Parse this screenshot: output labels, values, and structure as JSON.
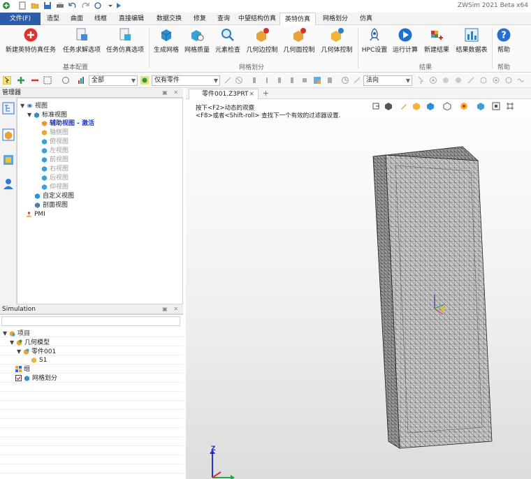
{
  "app": {
    "title": "ZWSim 2021 Beta x64"
  },
  "ribbon_tabs": [
    {
      "label": "文件(F)",
      "state": "file"
    },
    {
      "label": "造型"
    },
    {
      "label": "曲面"
    },
    {
      "label": "线框"
    },
    {
      "label": "直接编辑"
    },
    {
      "label": "数据交换"
    },
    {
      "label": "修复"
    },
    {
      "label": "查询"
    },
    {
      "label": "中望结构仿真"
    },
    {
      "label": "英特仿真",
      "state": "active"
    },
    {
      "label": "网格划分"
    },
    {
      "label": "仿真"
    }
  ],
  "ribbon": {
    "buttons": [
      {
        "label": "新建英特仿真任务",
        "icon": "add-icon"
      },
      {
        "label": "任务求解选项",
        "icon": "solver-options-icon"
      },
      {
        "label": "任务仿真选项",
        "icon": "simulation-options-icon"
      },
      {
        "label": "生成网格",
        "icon": "generate-mesh-icon"
      },
      {
        "label": "网格质量",
        "icon": "mesh-quality-icon"
      },
      {
        "label": "元素检查",
        "icon": "element-check-icon"
      },
      {
        "label": "几何边控制",
        "icon": "edge-control-icon"
      },
      {
        "label": "几何面控制",
        "icon": "face-control-icon"
      },
      {
        "label": "几何体控制",
        "icon": "body-control-icon"
      },
      {
        "label": "HPC设置",
        "icon": "hpc-rocket-icon"
      },
      {
        "label": "运行计算",
        "icon": "run-play-icon"
      },
      {
        "label": "新建结果",
        "icon": "new-result-icon"
      },
      {
        "label": "结果数据表",
        "icon": "result-table-icon"
      },
      {
        "label": "帮助",
        "icon": "help-icon"
      }
    ],
    "groups": {
      "basic": "基本配置",
      "mesh": "网格划分",
      "result": "结果",
      "help": "帮助"
    }
  },
  "toolbar2": {
    "filter_value": "全部",
    "part_filter_value": "仅有零件",
    "view_mode_value": "法向"
  },
  "manager": {
    "title": "管理器",
    "tree": [
      {
        "label": "视图",
        "level": 0,
        "expand": "▼",
        "icon": "view-folder-icon"
      },
      {
        "label": "标准视图",
        "level": 1,
        "expand": "▼",
        "icon": "standard-view-icon"
      },
      {
        "label": "辅助视图 - 激活",
        "level": 2,
        "icon": "aux-view-icon",
        "style": "active"
      },
      {
        "label": "轴侧图",
        "level": 2,
        "icon": "iso-view-icon",
        "style": "grey"
      },
      {
        "label": "俯视图",
        "level": 2,
        "icon": "top-view-icon",
        "style": "grey"
      },
      {
        "label": "左视图",
        "level": 2,
        "icon": "left-view-icon",
        "style": "grey"
      },
      {
        "label": "前视图",
        "level": 2,
        "icon": "front-view-icon",
        "style": "grey"
      },
      {
        "label": "右视图",
        "level": 2,
        "icon": "right-view-icon",
        "style": "grey"
      },
      {
        "label": "后视图",
        "level": 2,
        "icon": "back-view-icon",
        "style": "grey"
      },
      {
        "label": "仰视图",
        "level": 2,
        "icon": "bottom-view-icon",
        "style": "grey"
      },
      {
        "label": "自定义视图",
        "level": 1,
        "icon": "custom-view-icon"
      },
      {
        "label": "剖面视图",
        "level": 1,
        "icon": "section-view-icon"
      },
      {
        "label": "PMI",
        "level": 0,
        "icon": "pmi-icon"
      }
    ]
  },
  "simulation": {
    "title": "Simulation",
    "tree": [
      {
        "label": "项目",
        "level": 0,
        "expand": "▼",
        "icon": "project-icon"
      },
      {
        "label": "几何模型",
        "level": 1,
        "expand": "▼",
        "icon": "geometry-model-icon"
      },
      {
        "label": "零件001",
        "level": 2,
        "expand": "▼",
        "icon": "part-icon"
      },
      {
        "label": "S1",
        "level": 3,
        "icon": "solid-icon"
      },
      {
        "label": "组",
        "level": 0,
        "icon": "group-icon"
      },
      {
        "label": "网格划分",
        "level": 0,
        "icon": "mesh-icon",
        "checked": true
      }
    ]
  },
  "viewport": {
    "tab_label": "零件001.Z3PRT",
    "hint_line1": "按下<F2>动态的观察",
    "hint_line2": "<F8>或者<Shift-roll> 查找下一个有效的过滤器设置.",
    "axis_label": "Z"
  },
  "colors": {
    "file_tab": "#2a5caa",
    "active_view_text": "#1a33d6",
    "mesh_face": "#c8c8c8",
    "mesh_line": "#3c3c3c"
  }
}
